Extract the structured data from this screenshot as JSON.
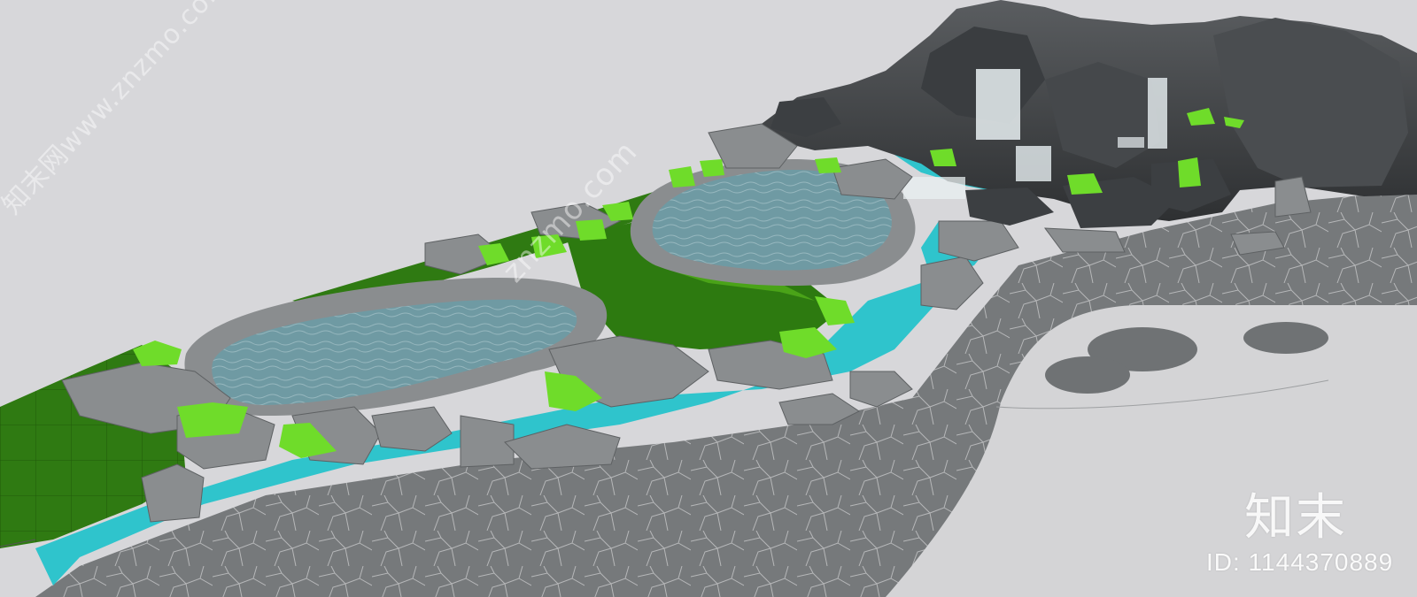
{
  "watermark": {
    "diagonal_left": "知末网www.znzmo.com",
    "diagonal_center": "znzmo.com",
    "brand_logo": "知末",
    "asset_id": "ID: 1144370889"
  },
  "colors": {
    "background": "#d7d7da",
    "paving": "#76797b",
    "paving_crack": "#c9cbcc",
    "plaza": "#d4d4d6",
    "stepping_stone": "#6f7274",
    "lawn_dark": "#2f7a12",
    "lawn_mid": "#3f9a16",
    "plant_bright": "#6fdc2a",
    "stream": "#2fc4cc",
    "pool_water": "#6f9aa3",
    "rock_light": "#8a8d8f",
    "rock_dark": "#3a3c3e",
    "waterfall": "#e9f0f2"
  }
}
